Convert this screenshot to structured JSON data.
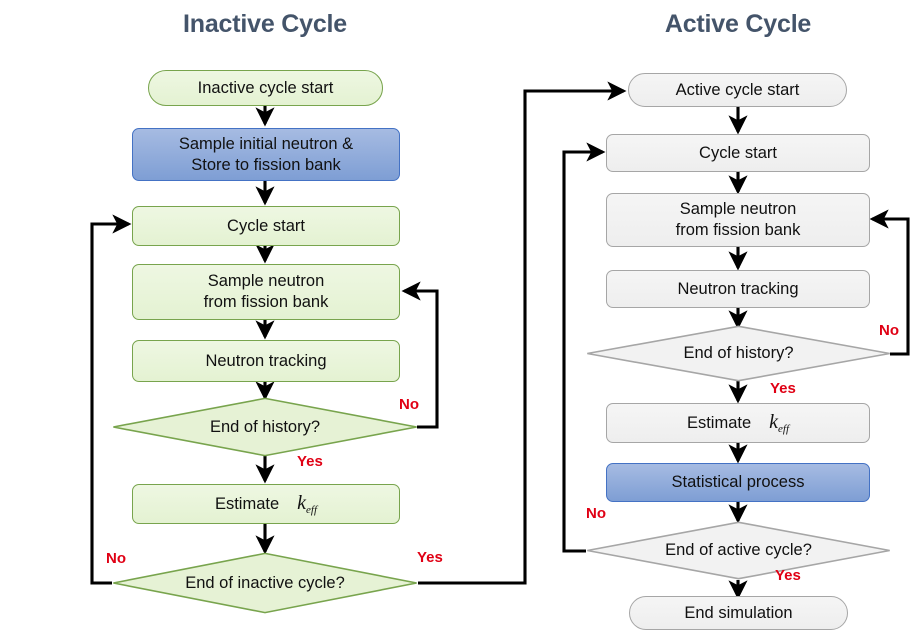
{
  "diagram": {
    "type": "flowchart",
    "titles": {
      "left": "Inactive Cycle",
      "right": "Active Cycle"
    },
    "colors": {
      "title": "#44546a",
      "green_fill": "#e8f4d9",
      "green_border": "#78a44d",
      "gray_fill": "#f2f2f2",
      "gray_border": "#a6a6a6",
      "blue_fill": "#8fa9db",
      "blue_border": "#4472c4",
      "edge_label": "#e00014",
      "connector": "#000000"
    },
    "inactive": {
      "start": "Inactive cycle start",
      "sample_initial": "Sample initial neutron &\nStore to fission bank",
      "sample_initial_line1": "Sample initial neutron &",
      "sample_initial_line2": "Store to fission bank",
      "cycle_start": "Cycle start",
      "sample_neutron_line1": "Sample neutron",
      "sample_neutron_line2": "from fission bank",
      "neutron_tracking": "Neutron tracking",
      "end_of_history": "End of history?",
      "estimate": "Estimate",
      "estimate_symbol": "k",
      "estimate_subscript": "eff",
      "end_of_inactive_cycle": "End of inactive cycle?",
      "label_history_no": "No",
      "label_history_yes": "Yes",
      "label_cycle_no": "No",
      "label_cycle_yes": "Yes"
    },
    "active": {
      "start": "Active cycle start",
      "cycle_start": "Cycle start",
      "sample_neutron_line1": "Sample neutron",
      "sample_neutron_line2": "from fission bank",
      "neutron_tracking": "Neutron tracking",
      "end_of_history": "End of history?",
      "estimate": "Estimate",
      "estimate_symbol": "k",
      "estimate_subscript": "eff",
      "statistical_process": "Statistical process",
      "end_of_active_cycle": "End of active cycle?",
      "end_simulation": "End simulation",
      "label_history_no": "No",
      "label_history_yes": "Yes",
      "label_cycle_no": "No",
      "label_cycle_yes": "Yes"
    }
  }
}
